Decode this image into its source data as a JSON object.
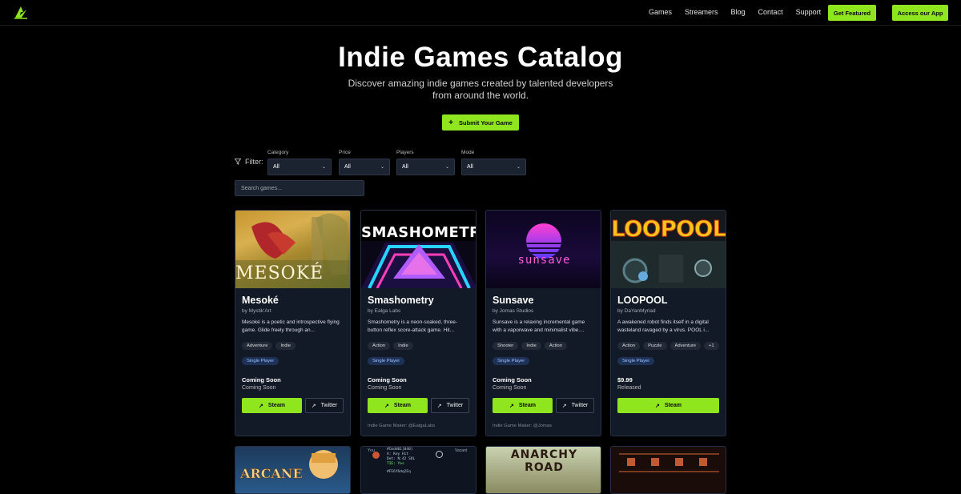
{
  "nav": {
    "links": [
      "Games",
      "Streamers",
      "Blog",
      "Contact",
      "Support"
    ],
    "get_featured": "Get Featured",
    "access_app": "Access our App"
  },
  "hero": {
    "title": "Indie Games Catalog",
    "subtitle": "Discover amazing indie games created by talented developers from around the world.",
    "submit_label": "Submit Your Game"
  },
  "filters": {
    "label": "Filter:",
    "category": {
      "label": "Category",
      "value": "All"
    },
    "price": {
      "label": "Price",
      "value": "All"
    },
    "players": {
      "label": "Players",
      "value": "All"
    },
    "mode": {
      "label": "Mode",
      "value": "All"
    },
    "search_placeholder": "Search games..."
  },
  "games": [
    {
      "title": "Mesoké",
      "by": "by Mystik'Art",
      "desc": "Mesoké is a poetic and introspective flying game. Glide freely through an...",
      "tags": [
        "Adventure",
        "Indie"
      ],
      "mode": "Single Player",
      "price": "Coming Soon",
      "status": "Coming Soon",
      "steam": "Steam",
      "twitter": "Twitter",
      "maker": "",
      "image_text": "MESOKÉ"
    },
    {
      "title": "Smashometry",
      "by": "by Ealga Labs",
      "desc": "Smashometry is a neon-soaked, three-button reflex score-attack game. Hit...",
      "tags": [
        "Action",
        "Indie"
      ],
      "mode": "Single Player",
      "price": "Coming Soon",
      "status": "Coming Soon",
      "steam": "Steam",
      "twitter": "Twitter",
      "maker": "Indie Game Maker: @EalgaLabs",
      "image_text": "SMASHOMETR"
    },
    {
      "title": "Sunsave",
      "by": "by Jomas Studios",
      "desc": "Sunsave is a relaxing incremental game with a vaporwave and minimalist vibe....",
      "tags": [
        "Shooter",
        "Indie",
        "Action"
      ],
      "mode": "Single Player",
      "price": "Coming Soon",
      "status": "Coming Soon",
      "steam": "Steam",
      "twitter": "Twitter",
      "maker": "Indie Game Maker: @Jomas",
      "image_text": "sunsave"
    },
    {
      "title": "LOOPOOL",
      "by": "by DaYanMyriad",
      "desc": "A awakened robot finds itself in a digital wasteland ravaged by a virus. POOL i...",
      "tags": [
        "Action",
        "Puzzle",
        "Adventure",
        "+1"
      ],
      "mode": "Single Player",
      "price": "$9.99",
      "status": "Released",
      "steam": "Steam",
      "twitter": "",
      "maker": "",
      "image_text": "LOOPOOL"
    }
  ],
  "second_row": {
    "arcane_text": "ARCANE",
    "anarchy_line1": "ANARCHY",
    "anarchy_line2": "ROAD",
    "vs_text_1": "You",
    "vs_text_2": "Vacant",
    "vs_line_1": "#Cmdd01[040]",
    "vs_line_2": "A: Key Hit",
    "vs_line_3": "Det: N:42 SOL",
    "vs_line_4": "TIE: Yes",
    "vs_line_5": "#FE6f6dq2Eq"
  },
  "colors": {
    "accent": "#8fe51e",
    "card_bg": "#121a27",
    "mode_badge": "#1e3258"
  }
}
